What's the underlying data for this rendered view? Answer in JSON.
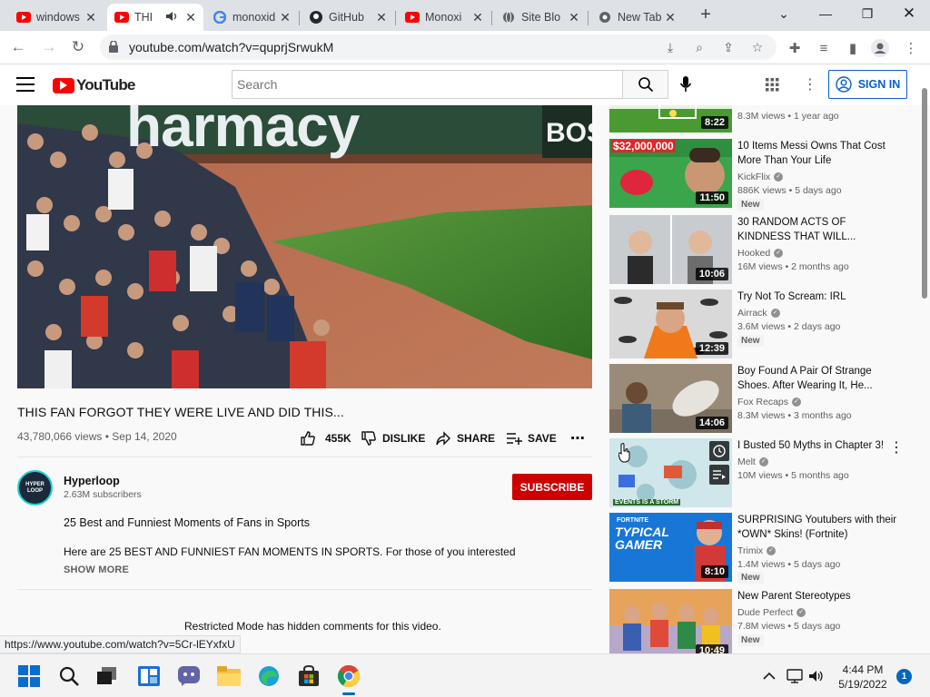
{
  "browser": {
    "tabs": [
      {
        "title": "windows",
        "favicon": "youtube-icon",
        "active": false
      },
      {
        "title": "THI",
        "favicon": "youtube-icon",
        "active": true,
        "audio": true
      },
      {
        "title": "monoxid",
        "favicon": "google-icon",
        "active": false
      },
      {
        "title": "GitHub",
        "favicon": "github-icon",
        "active": false
      },
      {
        "title": "Monoxi",
        "favicon": "youtube-icon",
        "active": false
      },
      {
        "title": "Site Blo",
        "favicon": "globe-icon",
        "active": false
      },
      {
        "title": "New Tab",
        "favicon": "chrome-icon",
        "active": false
      }
    ],
    "url": "youtube.com/watch?v=quprjSrwukM",
    "status_url": "https://www.youtube.com/watch?v=5Cr-lEYxfxU"
  },
  "youtube": {
    "logo_text": "YouTube",
    "search_placeholder": "Search",
    "signin_label": "SIGN IN"
  },
  "video": {
    "title": "THIS FAN FORGOT THEY WERE LIVE AND DID THIS...",
    "meta": "43,780,066 views • Sep 14, 2020",
    "like_count": "455K",
    "dislike_label": "DISLIKE",
    "share_label": "SHARE",
    "save_label": "SAVE",
    "banner_text": "harmacy",
    "banner_right": "BOS"
  },
  "channel": {
    "name": "Hyperloop",
    "subscribers": "2.63M subscribers",
    "avatar_text": "HYPER LOOP",
    "subscribe_label": "SUBSCRIBE"
  },
  "description": {
    "line1": "25 Best and Funniest Moments of Fans in Sports",
    "line2": "Here are 25 BEST AND FUNNIEST FAN MOMENTS IN SPORTS. For those of you interested on how I",
    "show_more": "SHOW MORE"
  },
  "comments": {
    "restricted_notice": "Restricted Mode has hidden comments for this video."
  },
  "recommendations": [
    {
      "title": "",
      "channel": "",
      "meta": "8.3M views • 1 year ago",
      "duration": "8:22",
      "new": false,
      "thumb": "#4a9a32"
    },
    {
      "title": "10 Items Messi Owns That Cost More Than Your Life",
      "channel": "KickFlix",
      "meta": "886K views • 5 days ago",
      "duration": "11:50",
      "new": true,
      "thumb_text": "$32,000,000",
      "thumb": "#3aa54a"
    },
    {
      "title": "30 RANDOM ACTS OF KINDNESS THAT WILL...",
      "channel": "Hooked",
      "meta": "16M views • 2 months ago",
      "duration": "10:06",
      "new": false,
      "thumb": "#c8ccd0"
    },
    {
      "title": "Try Not To Scream: IRL",
      "channel": "Airrack",
      "meta": "3.6M views • 2 days ago",
      "duration": "12:39",
      "new": true,
      "thumb": "#d9d9d9"
    },
    {
      "title": "Boy Found A Pair Of Strange Shoes. After Wearing It, He...",
      "channel": "Fox Recaps",
      "meta": "8.3M views • 3 months ago",
      "duration": "14:06",
      "new": false,
      "thumb": "#9a8b78"
    },
    {
      "title": "I Busted 50 Myths in Chapter 3!",
      "channel": "Melt",
      "meta": "10M views • 5 months ago",
      "duration": "",
      "new": false,
      "thumb_text": "EVENTS IS A STORM",
      "thumb": "#cfe6ea"
    },
    {
      "title": "SURPRISING Youtubers with their *OWN* Skins! (Fortnite)",
      "channel": "Trimix",
      "meta": "1.4M views • 5 days ago",
      "duration": "8:10",
      "new": true,
      "thumb_text": "TYPICAL GAMER",
      "thumb_sub": "FORTNITE",
      "thumb": "#1877d6"
    },
    {
      "title": "New Parent Stereotypes",
      "channel": "Dude Perfect",
      "meta": "7.8M views • 5 days ago",
      "duration": "10:49",
      "new": true,
      "thumb": "#e7a35a"
    }
  ],
  "taskbar": {
    "time": "4:44 PM",
    "date": "5/19/2022",
    "notifications": "1"
  },
  "colors": {
    "brand_red": "#ff0000",
    "subscribe": "#cc0000",
    "signin_blue": "#065fd4"
  }
}
